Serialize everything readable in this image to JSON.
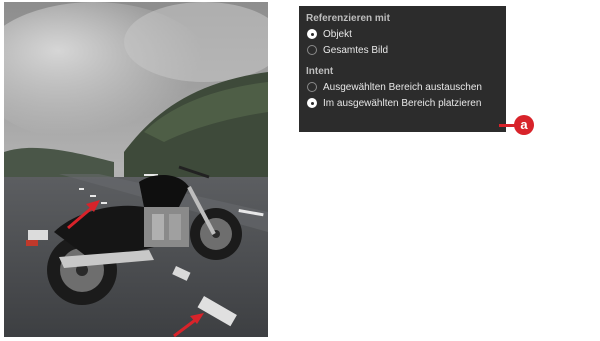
{
  "panel": {
    "section1_title": "Referenzieren mit",
    "options1": [
      {
        "label": "Objekt",
        "selected": true
      },
      {
        "label": "Gesamtes Bild",
        "selected": false
      }
    ],
    "section2_title": "Intent",
    "options2": [
      {
        "label": "Ausgewählten Bereich austauschen",
        "selected": false
      },
      {
        "label": "Im ausgewählten Bereich platzieren",
        "selected": true
      }
    ]
  },
  "callout": {
    "label": "a",
    "color": "#d8232a"
  },
  "photo": {
    "subject": "motorcycle on mountain road",
    "arrow_color": "#d8232a"
  }
}
